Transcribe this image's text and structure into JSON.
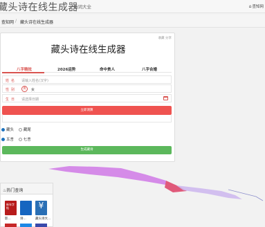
{
  "header": {
    "site_title": "藏头诗在线生成器",
    "nav_link": "诗词大全",
    "home_label": "查知网"
  },
  "breadcrumb": {
    "home": "查知网",
    "separator": "/",
    "current": "藏头诗在线生成器"
  },
  "card": {
    "actions": "收藏  分享",
    "title": "藏头诗在线生成器"
  },
  "tabs": [
    {
      "label": "八字精批",
      "active": true
    },
    {
      "label": "2026运势",
      "active": false
    },
    {
      "label": "命中贵人",
      "active": false
    },
    {
      "label": "八字合婚",
      "active": false
    }
  ],
  "form": {
    "name_label": "姓名",
    "name_placeholder": "请输入姓名(汉字)",
    "gender_label": "性别",
    "gender_male": "男",
    "gender_female": "女",
    "birth_label": "生日",
    "birth_placeholder": "请选择日期",
    "submit_label": "立即测算"
  },
  "options": {
    "position": [
      {
        "label": "藏头",
        "selected": true
      },
      {
        "label": "藏尾",
        "selected": false
      }
    ],
    "length": [
      {
        "label": "五言",
        "selected": true
      },
      {
        "label": "七言",
        "selected": false
      }
    ],
    "generate_label": "生成藏诗"
  },
  "hot": {
    "title": "热门查询",
    "items": [
      {
        "caption": "影...",
        "thumb": "新年字帖",
        "color": "#b71c1c"
      },
      {
        "caption": "诗...",
        "thumb": "",
        "color": "#1565c0"
      },
      {
        "caption": "藏头诗大...",
        "thumb": "¥",
        "color": "#2a6fb5"
      }
    ]
  },
  "colors": {
    "accent_red": "#d9534f",
    "button_red": "#ef5350",
    "button_green": "#5cb85c",
    "ribbon_purple": "#d58be8"
  }
}
